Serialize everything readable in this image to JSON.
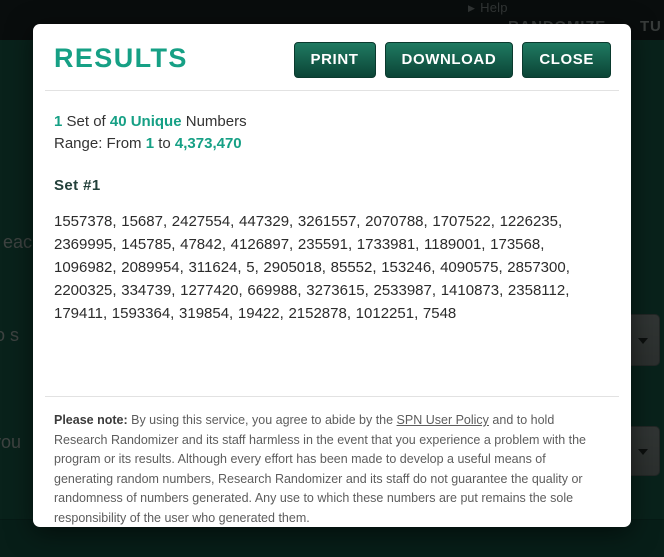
{
  "background": {
    "topbar": {
      "help_label": "Help",
      "help_caret": "▶",
      "nav_items": [
        "RANDOMIZE",
        "TU"
      ]
    },
    "panel_text_fragments": [
      "n eac",
      "to s",
      "you"
    ],
    "dropdowns": [
      {
        "name": "dropdown-top",
        "arrow": "▼"
      },
      {
        "name": "dropdown-bottom",
        "arrow": "▼"
      }
    ]
  },
  "modal": {
    "title": "RESULTS",
    "buttons": [
      {
        "label": "PRINT",
        "name": "print-button"
      },
      {
        "label": "DOWNLOAD",
        "name": "download-button"
      },
      {
        "label": "CLOSE",
        "name": "close-button"
      }
    ],
    "summary": {
      "set_count": "1",
      "set_of_text": " Set of ",
      "unique_count": "40 Unique",
      "numbers_text": " Numbers",
      "range_prefix": "Range: From ",
      "range_from": "1",
      "range_mid": " to ",
      "range_to": "4,373,470"
    },
    "set_label": "Set #1",
    "numbers": [
      1557378,
      15687,
      2427554,
      447329,
      3261557,
      2070788,
      1707522,
      1226235,
      2369995,
      145785,
      47842,
      4126897,
      235591,
      1733981,
      1189001,
      173568,
      1096982,
      2089954,
      311624,
      5,
      2905018,
      85552,
      153246,
      4090575,
      2857300,
      2200325,
      334739,
      1277420,
      669988,
      3273615,
      2533987,
      1410873,
      2358112,
      179411,
      1593364,
      319854,
      19422,
      2152878,
      1012251,
      7548
    ],
    "numbers_text": "1557378, 15687, 2427554, 447329, 3261557, 2070788, 1707522, 1226235, 2369995, 145785, 47842, 4126897, 235591, 1733981, 1189001, 173568, 1096982, 2089954, 311624, 5, 2905018, 85552, 153246, 4090575, 2857300, 2200325, 334739, 1277420, 669988, 3273615, 2533987, 1410873, 2358112, 179411, 1593364, 319854, 19422, 2152878, 1012251, 7548",
    "note": {
      "bold_prefix": "Please note:",
      "part1": " By using this service, you agree to abide by the ",
      "link": "SPN User Policy",
      "part2": " and to hold Research Randomizer and its staff harmless in the event that you experience a problem with the program or its results. Although every effort has been made to develop a useful means of generating random numbers, Research Randomizer and its staff do not guarantee the quality or randomness of numbers generated. Any use to which these numbers are put remains the sole responsibility of the user who generated them."
    }
  },
  "colors": {
    "accent_green": "#16a085",
    "button_dark": "#0b4436",
    "panel_green": "#15614d",
    "modal_bg": "#ffffff"
  }
}
